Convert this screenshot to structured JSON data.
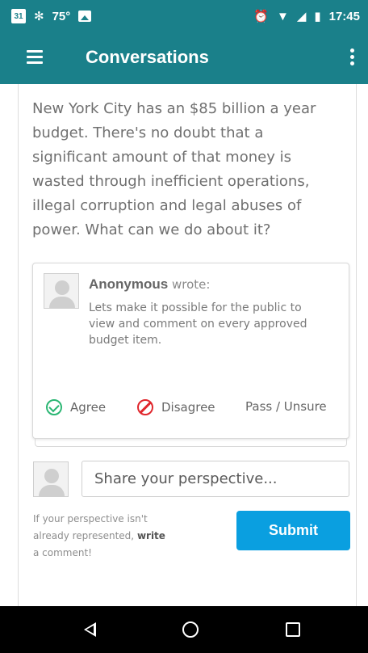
{
  "status_bar": {
    "calendar_day": "31",
    "temperature": "75°",
    "time": "17:45",
    "icons": [
      "calendar-icon",
      "fan-icon",
      "image-icon",
      "alarm-icon",
      "wifi-icon",
      "signal-icon",
      "battery-icon"
    ]
  },
  "app_bar": {
    "title": "Conversations",
    "background": "#1a808a"
  },
  "question": {
    "text": "New York City has an $85 billion a year budget. There's no doubt that a significant amount of that money is wasted through inefficient operations, illegal corruption and legal abuses of power. What can we do about it?"
  },
  "comment": {
    "author": "Anonymous",
    "wrote_label": "wrote:",
    "text": "Lets make it possible for the public to view and comment on every approved budget item."
  },
  "votes": {
    "agree_label": "Agree",
    "disagree_label": "Disagree",
    "pass_label": "Pass / Unsure",
    "agree_color": "#2bb673",
    "disagree_color": "#e0262c"
  },
  "compose": {
    "placeholder": "Share your perspective...",
    "hint_prefix": "If your perspective isn't already represented,",
    "hint_bold": "write",
    "hint_suffix": "a comment!",
    "submit_label": "Submit",
    "submit_color": "#0a9fe0"
  },
  "nav_bar": {
    "icons": [
      "back-icon",
      "home-icon",
      "recents-icon"
    ]
  }
}
